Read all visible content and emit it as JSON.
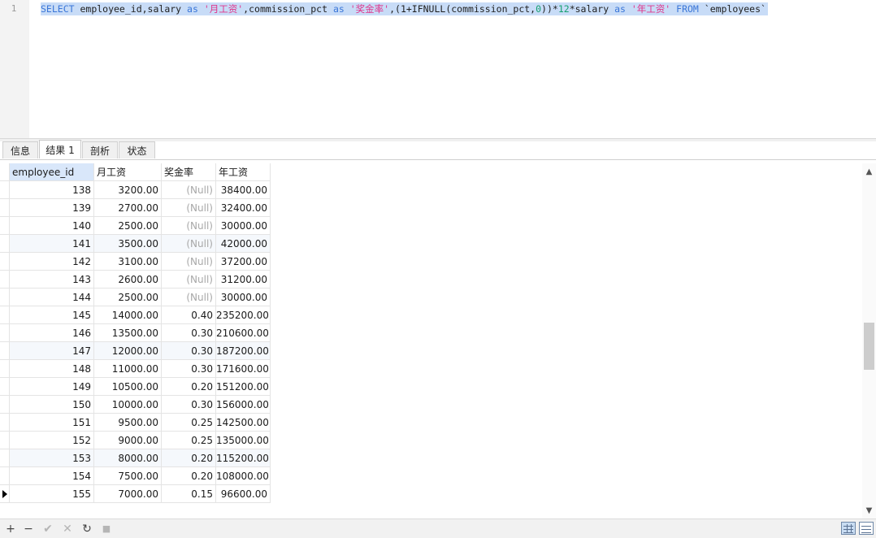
{
  "editor": {
    "line_number": "1",
    "sql": {
      "kw_select": "SELECT",
      "t1": " employee_id,salary ",
      "kw_as1": "as",
      "s1": " '月工资'",
      "t2": ",commission_pct ",
      "kw_as2": "as",
      "s2": " '奖金率'",
      "t3": ",(1+IFNULL(commission_pct,",
      "n0": "0",
      "t4": "))*",
      "n12": "12",
      "t5": "*salary ",
      "kw_as3": "as",
      "s3": " '年工资'",
      "kw_from": " FROM",
      "t6": " `employees`"
    }
  },
  "tabs": [
    {
      "label": "信息"
    },
    {
      "label": "结果 1"
    },
    {
      "label": "剖析"
    },
    {
      "label": "状态"
    }
  ],
  "result": {
    "columns": [
      "employee_id",
      "月工资",
      "奖金率",
      "年工资"
    ],
    "rows": [
      [
        "138",
        "3200.00",
        "(Null)",
        "38400.00"
      ],
      [
        "139",
        "2700.00",
        "(Null)",
        "32400.00"
      ],
      [
        "140",
        "2500.00",
        "(Null)",
        "30000.00"
      ],
      [
        "141",
        "3500.00",
        "(Null)",
        "42000.00"
      ],
      [
        "142",
        "3100.00",
        "(Null)",
        "37200.00"
      ],
      [
        "143",
        "2600.00",
        "(Null)",
        "31200.00"
      ],
      [
        "144",
        "2500.00",
        "(Null)",
        "30000.00"
      ],
      [
        "145",
        "14000.00",
        "0.40",
        "235200.00"
      ],
      [
        "146",
        "13500.00",
        "0.30",
        "210600.00"
      ],
      [
        "147",
        "12000.00",
        "0.30",
        "187200.00"
      ],
      [
        "148",
        "11000.00",
        "0.30",
        "171600.00"
      ],
      [
        "149",
        "10500.00",
        "0.20",
        "151200.00"
      ],
      [
        "150",
        "10000.00",
        "0.30",
        "156000.00"
      ],
      [
        "151",
        "9500.00",
        "0.25",
        "142500.00"
      ],
      [
        "152",
        "9000.00",
        "0.25",
        "135000.00"
      ],
      [
        "153",
        "8000.00",
        "0.20",
        "115200.00"
      ],
      [
        "154",
        "7500.00",
        "0.20",
        "108000.00"
      ],
      [
        "155",
        "7000.00",
        "0.15",
        "96600.00"
      ]
    ]
  },
  "toolbar": {
    "add": "+",
    "remove": "−",
    "apply": "✔",
    "discard": "✕",
    "refresh": "↻",
    "stop": "■"
  },
  "scroll": {
    "up": "▲",
    "down": "▼"
  }
}
